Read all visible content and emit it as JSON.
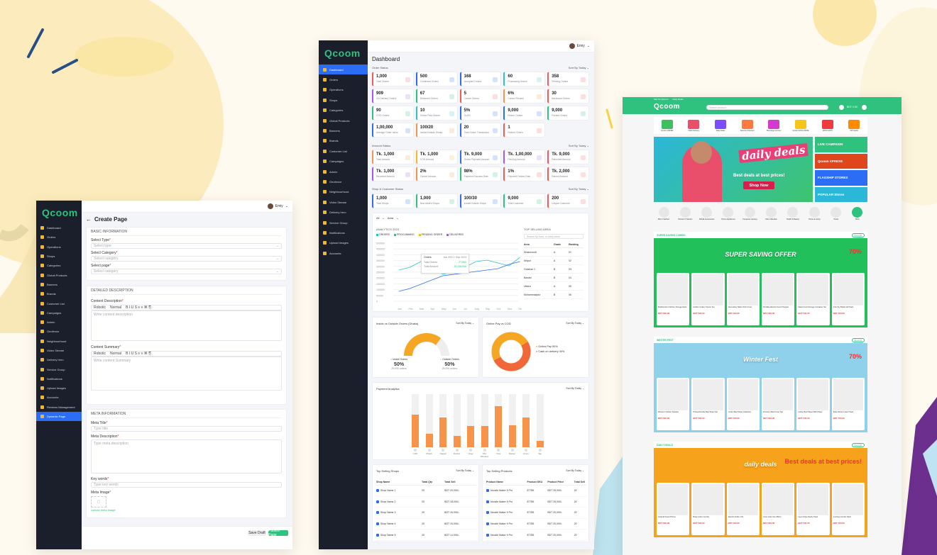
{
  "colors": {
    "accent": "#2ec27e",
    "primary": "#2c6df5",
    "orange": "#f7944a",
    "sidebar": "#1b1e2b"
  },
  "brand": "Qcoom",
  "create_page": {
    "user": "Emiy",
    "title": "Create Page",
    "nav": [
      "Dashboard",
      "Orders",
      "Operations",
      "Shops",
      "Categories",
      "Global Products",
      "Banners",
      "Brands",
      "Customer List",
      "Campaigns",
      "Admin",
      "Geofence",
      "Neighbourhood",
      "Video Stream",
      "Delivery hero",
      "Service Group",
      "Notifications",
      "Upload Images",
      "Accounts",
      "Reviews Management",
      "Dynamic Page"
    ],
    "basic_title": "BASIC INFORMATION",
    "select_type_label": "Select Type",
    "select_type_ph": "Select type",
    "select_category_label": "Select Category",
    "select_category_ph": "Select category",
    "select_page_label": "Select page",
    "select_page_ph": "Select category",
    "detail_title": "DETAILED DESCRIPTION",
    "content_desc_label": "Content Description",
    "content_desc_ph": "Write content description",
    "content_summary_label": "Content Summary",
    "content_summary_ph": "Write content Summary",
    "toolbar_style": "Robotic",
    "toolbar_size": "Normal",
    "meta_title_head": "META INFORMATION",
    "meta_title_label": "Meta Title",
    "meta_title_ph": "Type title",
    "meta_desc_label": "Meta Description",
    "meta_desc_ph": "Type meta description",
    "keywords_label": "Key words",
    "keywords_ph": "Type key words",
    "meta_image_label": "Meta Image",
    "upload_link": "Upload meta image",
    "save_draft": "Save Draft",
    "publish": "Publish Page"
  },
  "dashboard": {
    "user": "Emiy",
    "title": "Dashboard",
    "nav": [
      "Dashboard",
      "Orders",
      "Operations",
      "Shops",
      "Categories",
      "Global Products",
      "Banners",
      "Brands",
      "Customer List",
      "Campaigns",
      "Admin",
      "Geofence",
      "Neighbourhood",
      "Video Stream",
      "Delivery hero",
      "Service Group",
      "Notifications",
      "Upload Images",
      "Accounts"
    ],
    "order_status": "Order Status",
    "sort_by": "Sort By Today",
    "stats1": [
      {
        "v": "1,000",
        "l": "Total Orders",
        "c": "#f05a5a"
      },
      {
        "v": "500",
        "l": "Confirmed Orders",
        "c": "#2c6df5"
      },
      {
        "v": "168",
        "l": "Accepted Orders",
        "c": "#2c6df5"
      },
      {
        "v": "60",
        "l": "Processing Orders",
        "c": "#2ec2c2"
      },
      {
        "v": "358",
        "l": "Pending Orders",
        "c": "#f05a5a"
      },
      {
        "v": "909",
        "l": "On Delivery Orders",
        "c": "#a45af0"
      },
      {
        "v": "67",
        "l": "Delivered Orders",
        "c": "#2ec27e"
      },
      {
        "v": "5",
        "l": "Cancel Orders",
        "c": "#f05a5a"
      },
      {
        "v": "6%",
        "l": "Cancel Percent",
        "c": "#f7944a"
      },
      {
        "v": "30",
        "l": "Backward Orders",
        "c": "#f05a5a"
      },
      {
        "v": "90",
        "l": "COD Orders",
        "c": "#2ec27e"
      },
      {
        "v": "10",
        "l": "Online Paid Orders",
        "c": "#2ec2c2"
      },
      {
        "v": "5%",
        "l": "SLA%",
        "c": "#2c6df5"
      },
      {
        "v": "9,000",
        "l": "Return Orders",
        "c": "#2c6df5"
      },
      {
        "v": "9,000",
        "l": "Packed Orders",
        "c": "#2ec27e"
      },
      {
        "v": "1,00,000",
        "l": "Average Order Value",
        "c": "#2c6df5"
      },
      {
        "v": "100/20",
        "l": "Inside/Outside Dhaka",
        "c": "#f7944a"
      },
      {
        "v": "20",
        "l": "Total Online Transaction",
        "c": "#2c6df5"
      },
      {
        "v": "1",
        "l": "Refund Orders",
        "c": "#f05a5a"
      }
    ],
    "amount_status": "Amount Status",
    "stats2": [
      {
        "v": "Tk. 1,000",
        "l": "Total Amount",
        "c": "#f7944a"
      },
      {
        "v": "Tk. 1,000",
        "l": "COD Amount",
        "c": "#f5b72a"
      },
      {
        "v": "Tk. 9,000",
        "l": "Online Payment Amount",
        "c": "#2c6df5"
      },
      {
        "v": "Tk. 1,00,000",
        "l": "Pending Amount",
        "c": "#a45af0"
      },
      {
        "v": "Tk. 9,000",
        "l": "Refunded Amount",
        "c": "#f05a5a"
      },
      {
        "v": "Tk. 1,000",
        "l": "Received Amount",
        "c": "#a45af0"
      },
      {
        "v": "2%",
        "l": "Cancel Amount",
        "c": "#f7944a"
      },
      {
        "v": "98%",
        "l": "Payment Success Rate",
        "c": "#2ec27e"
      },
      {
        "v": "1%",
        "l": "Payment Failure Rate",
        "c": "#f05a5a"
      },
      {
        "v": "Tk. 2,000",
        "l": "Refund Amount",
        "c": "#f05a5a"
      }
    ],
    "shop_status": "Shop & Customer Status",
    "stats3": [
      {
        "v": "1,000",
        "l": "Total Shops",
        "c": "#2c6df5"
      },
      {
        "v": "1,000",
        "l": "New Added Shops",
        "c": "#2ec27e"
      },
      {
        "v": "100/30",
        "l": "Inside/Outside Shops",
        "c": "#2c6df5"
      },
      {
        "v": "9,000",
        "l": "Total Customer",
        "c": "#2ec27e"
      },
      {
        "v": "200",
        "l": "Unique Customer",
        "c": "#f05a5a"
      }
    ],
    "filter_all": "All",
    "filter_area": "Area",
    "analytics_title": "ANALYTICS 2023",
    "legend": [
      "ORDERS",
      "PROCUMMING",
      "PENDING ORDER",
      "DELIVERED"
    ],
    "tooltip": {
      "title": "Orders",
      "date": "Jun 2021 / Sep 2023",
      "rows": [
        [
          "Total Orders",
          "27,800"
        ],
        [
          "Total Amount",
          "20,228,946"
        ]
      ]
    },
    "top_area_title": "TOP SELLING AREA",
    "top_area_search": "Search by Area, or Area name",
    "top_area_head": [
      "Area",
      "Grade",
      "Ranking"
    ],
    "top_area_rows": [
      [
        "Dhanmondi",
        "A",
        "01"
      ],
      [
        "Mirpur",
        "A",
        "02"
      ],
      [
        "Gulshan 1",
        "B",
        "03"
      ],
      [
        "Banani",
        "B",
        "04"
      ],
      [
        "Uttara",
        "A",
        "05"
      ],
      [
        "Mohammadpur",
        "B",
        "06"
      ]
    ],
    "inside_title": "Inside vs Outside Orders (Dhaka)",
    "inside_label": "Inside Orders",
    "inside_pct": "50%",
    "inside_sub": "25,000 orders",
    "outside_label": "Outside Orders",
    "outside_pct": "50%",
    "outside_sub": "25,000 orders",
    "online_title": "Online Pay vs COD",
    "online_legend": [
      "Online Pay 50%",
      "Cash on delivery 40%"
    ],
    "payment_title": "Payment Analytics",
    "pay_labels": [
      "COD",
      "bKash",
      "Nagad",
      "Rocket",
      "Upay",
      "SSL Wireless",
      "Visa",
      "Master",
      "Amex",
      "Tap"
    ],
    "top_shops_title": "Top Selling Shops",
    "shops_head": [
      "Shop Name",
      "Total Qty",
      "Total Sell"
    ],
    "shops": [
      [
        "Shop Name 1",
        "20",
        "BDT 20,000/-"
      ],
      [
        "Shop Name 2",
        "20",
        "BDT 18,000/-"
      ],
      [
        "Shop Name 3",
        "20",
        "BDT 16,000/-"
      ],
      [
        "Shop Name 4",
        "20",
        "BDT 15,000/-"
      ],
      [
        "Shop Name 5",
        "20",
        "BDT 14,000/-"
      ]
    ],
    "top_products_title": "Top Selling Products",
    "prod_head": [
      "Product Name",
      "Product SKU",
      "Product Price",
      "Total Sell"
    ],
    "products": [
      [
        "Noodle Maker 9 Pro",
        "87785",
        "BDT 20,000/-",
        "20"
      ],
      [
        "Noodle Maker 9 Pro",
        "87785",
        "BDT 20,000/-",
        "20"
      ],
      [
        "Noodle Maker 9 Pro",
        "87785",
        "BDT 20,000/-",
        "20"
      ],
      [
        "Noodle Maker 9 Pro",
        "87785",
        "BDT 20,000/-",
        "20"
      ],
      [
        "Noodle Maker 9 Pro",
        "87785",
        "BDT 20,000/-",
        "20"
      ]
    ]
  },
  "storefront": {
    "top_links": [
      "Sell On Qcoom",
      "Daily Deals"
    ],
    "search_ph": "Search product",
    "cart": "Cart",
    "balance": "BDT 0.00",
    "categories": [
      "Qcoom OFFER",
      "Flash Delivery",
      "Daily Deals",
      "Sweets & Dessert",
      "Beverage Grocery",
      "Qcoom EXCLUSIVE",
      "100% CASH",
      "Gift Cards"
    ],
    "hero_title": "daily deals",
    "hero_sub": "Best deals at best prices!",
    "hero_cta": "Shop Now",
    "side_banners": [
      "LIVE CAMPAIGN",
      "Qcoom XPRESS",
      "FLAGSHIP STORES",
      "POPULAR Stores"
    ],
    "cat_row": [
      "Men's Fashion",
      "Women's Fashion",
      "Mobile Accessories",
      "Home Appliances",
      "Computer Gaming",
      "Kids Collection",
      "Health & Beauty",
      "Home & Living",
      "Travel",
      "More"
    ],
    "sec1": "SUPER SAVING COMBO",
    "sec1_banner": "SUPER SAVING OFFER",
    "sec1_pct": "70%",
    "sec1_off": "UP TO",
    "sec1_products": [
      "Multifunction Kitchen Storage Rack",
      "Golden Cutlery Spoon Set",
      "Decorative Table Cloth Cover",
      "Portable Electric Food Chopper",
      "Glass Food Storage Container Set",
      "Kids Toy Bottle Gift Pack"
    ],
    "sec2": "WINTER FEST",
    "sec2_banner": "Winter Fest",
    "sec2_pct": "70%",
    "sec2_products": [
      "Women's Winter Sweater",
      "Printed Double Bed Sheet Set",
      "Cotton Bed Sheet Collection",
      "Premium Bed Cover Set",
      "Cotton Bed Sheet With Pillow",
      "Baby Winter Lotion Pack"
    ],
    "sec3": "DAILY DEALS",
    "sec3_banner": "daily deals",
    "sec3_sub": "Best deals at best prices!",
    "sec3_products": [
      "Android Smart Phone",
      "Body Lotion Combo",
      "Electric Kettle 1.8L",
      "Coca Cola Can 250ml",
      "Lays Chips Family Pack",
      "Ketchup Combo Pack"
    ],
    "view_all": "View All",
    "price": "BDT 500.00"
  }
}
